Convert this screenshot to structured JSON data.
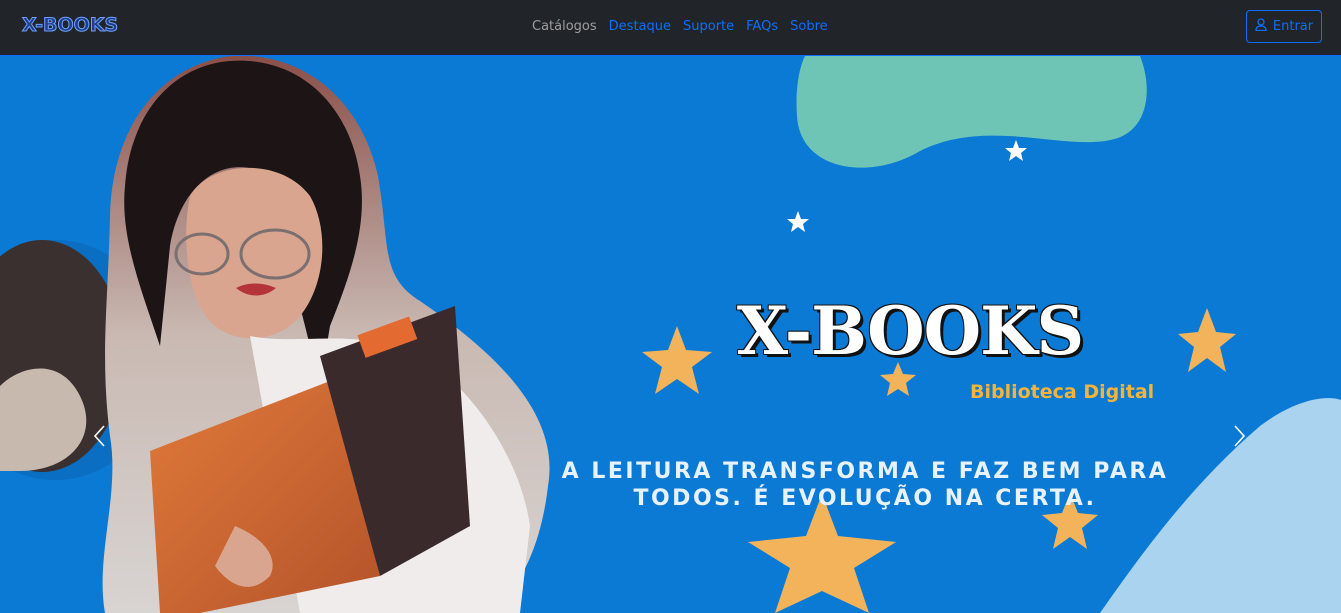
{
  "brand": {
    "logo_text": "X-BOOKS"
  },
  "nav": {
    "links": [
      {
        "label": "Catálogos",
        "active": true
      },
      {
        "label": "Destaque",
        "active": false
      },
      {
        "label": "Suporte",
        "active": false
      },
      {
        "label": "FAQs",
        "active": false
      },
      {
        "label": "Sobre",
        "active": false
      }
    ],
    "login_label": "Entrar"
  },
  "hero": {
    "title": "X-BOOKS",
    "subtitle": "Biblioteca Digital",
    "tagline": "A LEITURA TRANSFORMA E FAZ BEM PARA TODOS. É EVOLUÇÃO NA CERTA."
  },
  "icons": {
    "login": "person-icon",
    "prev": "chevron-left-icon",
    "next": "chevron-right-icon"
  },
  "colors": {
    "navbar_bg": "#212529",
    "link_blue": "#0d6efd",
    "hero_bg": "#0b7ad4",
    "accent_gold": "#f4b43a",
    "blob_mint": "#6fc5b5",
    "blob_light": "#a9d3ef"
  }
}
